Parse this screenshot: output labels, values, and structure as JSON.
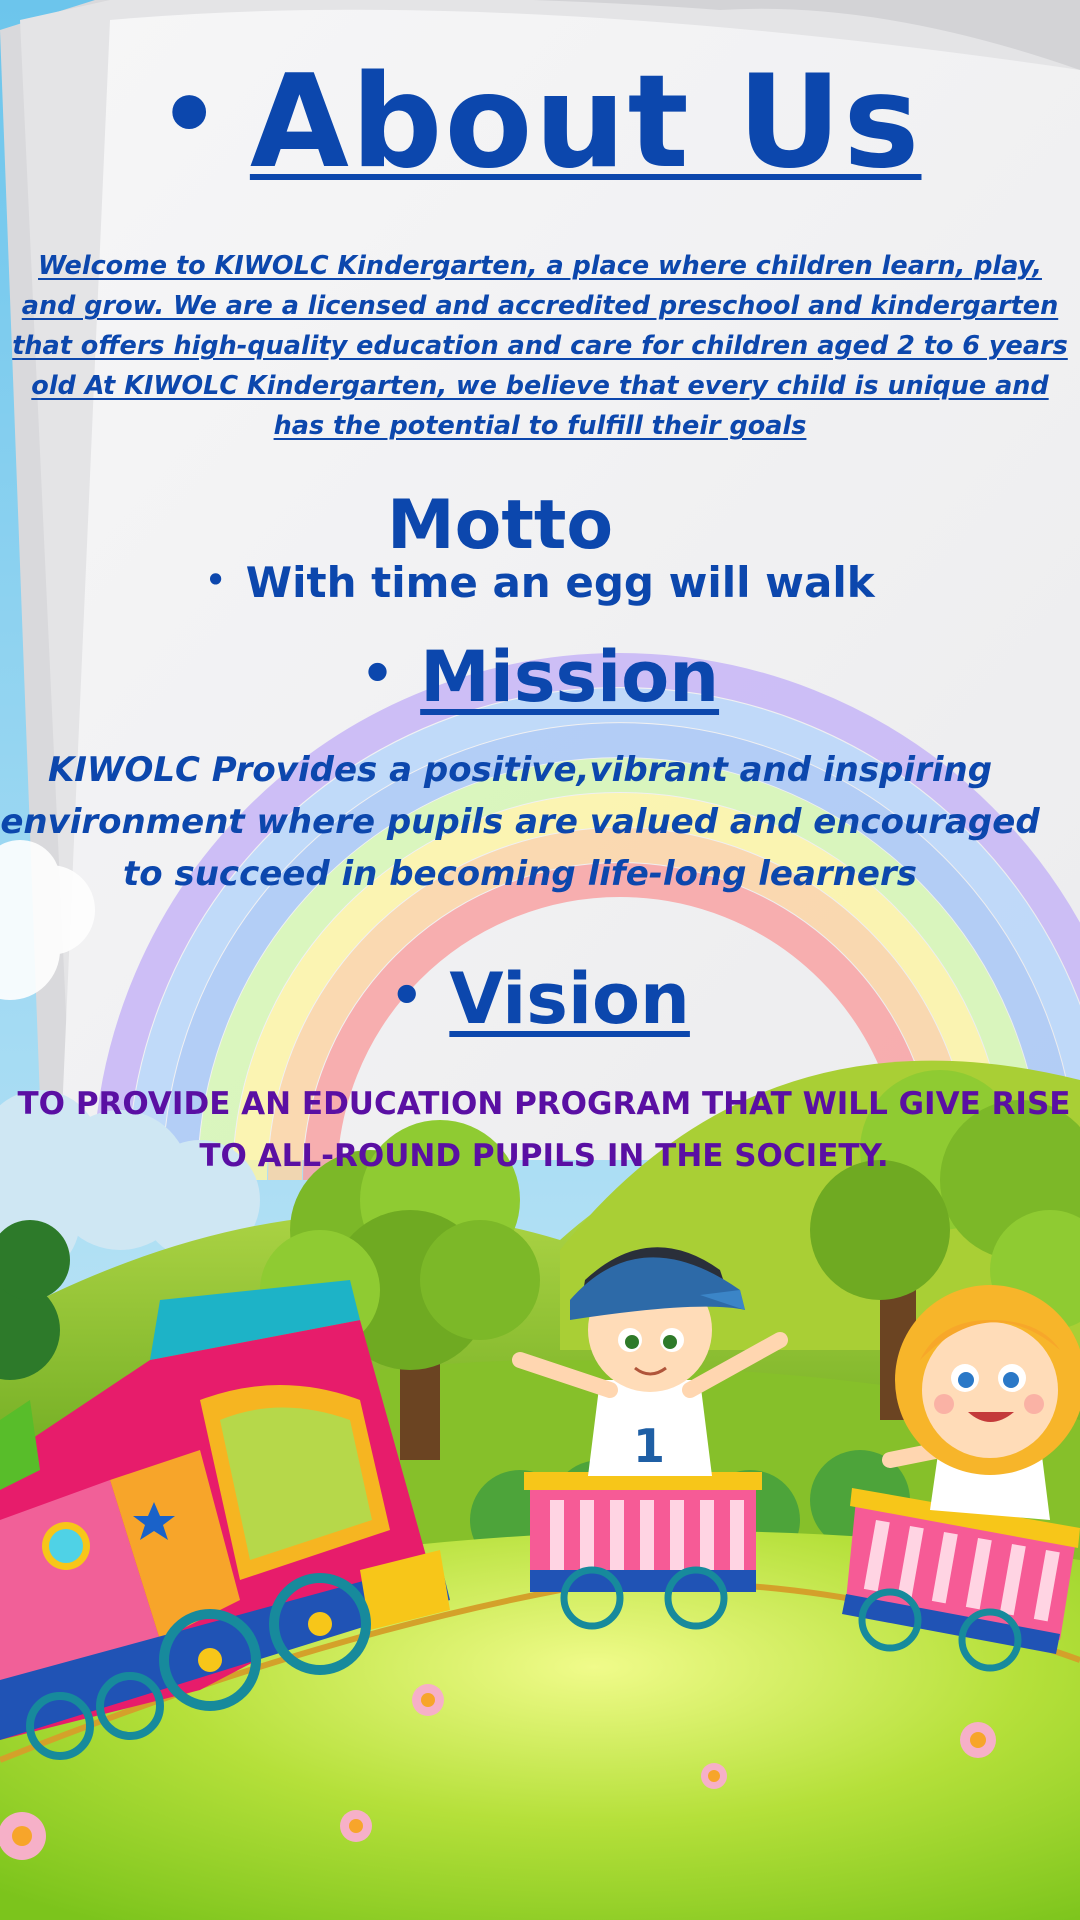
{
  "about": {
    "bullet": "•",
    "title": "About Us",
    "intro": "Welcome to KIWOLC  Kindergarten, a place where children learn, play, and grow. We are a licensed and accredited preschool and kindergarten that offers high-quality education and care for children aged 2 to 6 years old At KIWOLC Kindergarten, we believe that every child is unique and has the potential to fulfill their goals "
  },
  "motto": {
    "title": "Motto",
    "bullet": "•",
    "text": "With time an egg will walk"
  },
  "mission": {
    "bullet": "•",
    "title": "Mission ",
    "text": "KIWOLC Provides a positive,vibrant and inspiring environment where pupils are valued and encouraged to succeed in becoming life-long learners"
  },
  "vision": {
    "bullet": "•",
    "title": "Vision ",
    "text": "TO PROVIDE AN EDUCATION PROGRAM THAT WILL GIVE RISE TO ALL-ROUND PUPILS IN THE SOCIETY."
  },
  "boy_shirt_number": "1",
  "colors": {
    "heading_blue": "#0c47ad",
    "vision_purple": "#5a0fa3",
    "grass": "#a6d62a",
    "sky": "#bfe3f4"
  }
}
